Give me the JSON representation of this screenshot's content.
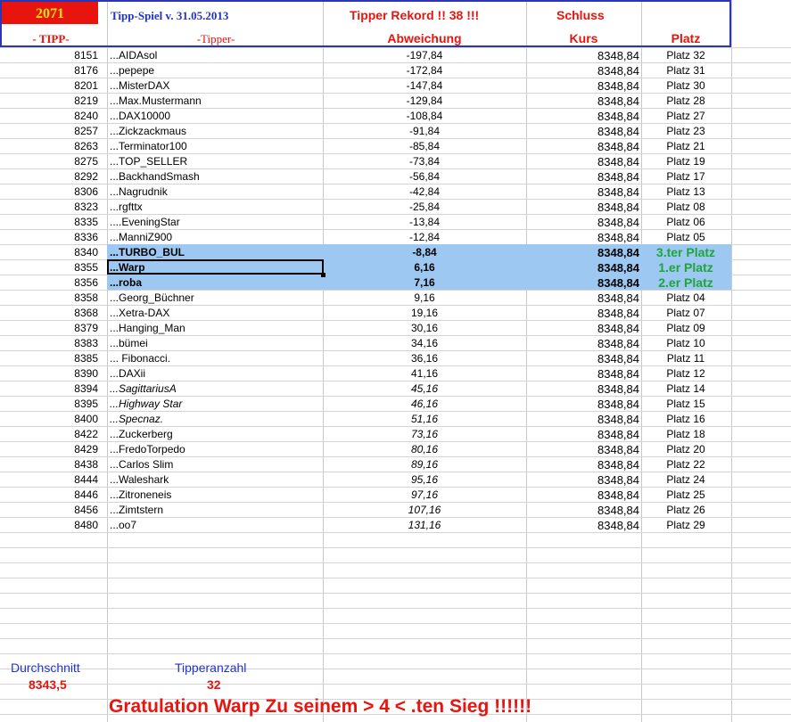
{
  "header": {
    "id_cell": "2071",
    "title": "Tipp-Spiel v. 31.05.2013",
    "record": "Tipper Rekord !!  38  !!!",
    "schluss": "Schluss",
    "col_tipp": "- TIPP-",
    "col_tipper": "-Tipper-",
    "col_abweichung": "Abweichung",
    "col_kurs": "Kurs",
    "col_platz": "Platz"
  },
  "rows": [
    {
      "tipp": "8151",
      "name": "...AIDAsol",
      "abw": "-197,84",
      "kurs": "8348,84",
      "platz": "Platz 32"
    },
    {
      "tipp": "8176",
      "name": "...pepepe",
      "abw": "-172,84",
      "kurs": "8348,84",
      "platz": "Platz 31"
    },
    {
      "tipp": "8201",
      "name": "...MisterDAX",
      "abw": "-147,84",
      "kurs": "8348,84",
      "platz": "Platz 30"
    },
    {
      "tipp": "8219",
      "name": "...Max.Mustermann",
      "abw": "-129,84",
      "kurs": "8348,84",
      "platz": "Platz 28"
    },
    {
      "tipp": "8240",
      "name": "...DAX10000",
      "abw": "-108,84",
      "kurs": "8348,84",
      "platz": "Platz 27"
    },
    {
      "tipp": "8257",
      "name": "...Zickzackmaus",
      "abw": "-91,84",
      "kurs": "8348,84",
      "platz": "Platz 23"
    },
    {
      "tipp": "8263",
      "name": "...Terminator100",
      "abw": "-85,84",
      "kurs": "8348,84",
      "platz": "Platz 21"
    },
    {
      "tipp": "8275",
      "name": "...TOP_SELLER",
      "abw": "-73,84",
      "kurs": "8348,84",
      "platz": "Platz 19"
    },
    {
      "tipp": "8292",
      "name": "...BackhandSmash",
      "abw": "-56,84",
      "kurs": "8348,84",
      "platz": "Platz 17"
    },
    {
      "tipp": "8306",
      "name": "...Nagrudnik",
      "abw": "-42,84",
      "kurs": "8348,84",
      "platz": "Platz 13"
    },
    {
      "tipp": "8323",
      "name": "...rgfttx",
      "abw": "-25,84",
      "kurs": "8348,84",
      "platz": "Platz 08"
    },
    {
      "tipp": "8335",
      "name": "....EveningStar",
      "abw": "-13,84",
      "kurs": "8348,84",
      "platz": "Platz 06"
    },
    {
      "tipp": "8336",
      "name": "...ManniZ900",
      "abw": "-12,84",
      "kurs": "8348,84",
      "platz": "Platz 05"
    },
    {
      "tipp": "8340",
      "name": "...TURBO_BUL",
      "abw": "-8,84",
      "kurs": "8348,84",
      "platz": "3.ter Platz"
    },
    {
      "tipp": "8355",
      "name": "...Warp",
      "abw": "6,16",
      "kurs": "8348,84",
      "platz": "1.er Platz"
    },
    {
      "tipp": "8356",
      "name": "...roba",
      "abw": "7,16",
      "kurs": "8348,84",
      "platz": "2.er Platz"
    },
    {
      "tipp": "8358",
      "name": "...Georg_Büchner",
      "abw": "9,16",
      "kurs": "8348,84",
      "platz": "Platz 04"
    },
    {
      "tipp": "8368",
      "name": "...Xetra-DAX",
      "abw": "19,16",
      "kurs": "8348,84",
      "platz": "Platz 07"
    },
    {
      "tipp": "8379",
      "name": "...Hanging_Man",
      "abw": "30,16",
      "kurs": "8348,84",
      "platz": "Platz 09"
    },
    {
      "tipp": "8383",
      "name": "...bümei",
      "abw": "34,16",
      "kurs": "8348,84",
      "platz": "Platz 10"
    },
    {
      "tipp": "8385",
      "name": "... Fibonacci.",
      "abw": "36,16",
      "kurs": "8348,84",
      "platz": "Platz 11"
    },
    {
      "tipp": "8390",
      "name": "...DAXii",
      "abw": "41,16",
      "kurs": "8348,84",
      "platz": "Platz 12"
    },
    {
      "tipp": "8394",
      "name": "...SagittariusA",
      "abw": "45,16",
      "kurs": "8348,84",
      "platz": "Platz 14"
    },
    {
      "tipp": "8395",
      "name": "...Highway Star",
      "abw": "46,16",
      "kurs": "8348,84",
      "platz": "Platz 15"
    },
    {
      "tipp": "8400",
      "name": "...Specnaz.",
      "abw": "51,16",
      "kurs": "8348,84",
      "platz": "Platz 16"
    },
    {
      "tipp": "8422",
      "name": "...Zuckerberg",
      "abw": "73,16",
      "kurs": "8348,84",
      "platz": "Platz 18"
    },
    {
      "tipp": "8429",
      "name": "...FredoTorpedo",
      "abw": "80,16",
      "kurs": "8348,84",
      "platz": "Platz 20"
    },
    {
      "tipp": "8438",
      "name": "...Carlos Slim",
      "abw": "89,16",
      "kurs": "8348,84",
      "platz": "Platz 22"
    },
    {
      "tipp": "8444",
      "name": "...Waleshark",
      "abw": "95,16",
      "kurs": "8348,84",
      "platz": "Platz 24"
    },
    {
      "tipp": "8446",
      "name": "...Zitroneneis",
      "abw": "97,16",
      "kurs": "8348,84",
      "platz": "Platz 25"
    },
    {
      "tipp": "8456",
      "name": "...Zimtstern",
      "abw": "107,16",
      "kurs": "8348,84",
      "platz": "Platz 26"
    },
    {
      "tipp": "8480",
      "name": "...oo7",
      "abw": "131,16",
      "kurs": "8348,84",
      "platz": "Platz 29"
    }
  ],
  "footer": {
    "avg_label": "Durchschnitt",
    "avg_value": "8343,5",
    "count_label": "Tipperanzahl",
    "count_value": "32",
    "congrats": "Gratulation Warp  Zu seinem > 4 < .ten Sieg !!!!!!"
  },
  "colors": {
    "red": "#e8140e",
    "green": "#1fa53a",
    "blue": "#2033cc",
    "highlight": "#9cc8f2",
    "border": "#2b35b8"
  }
}
